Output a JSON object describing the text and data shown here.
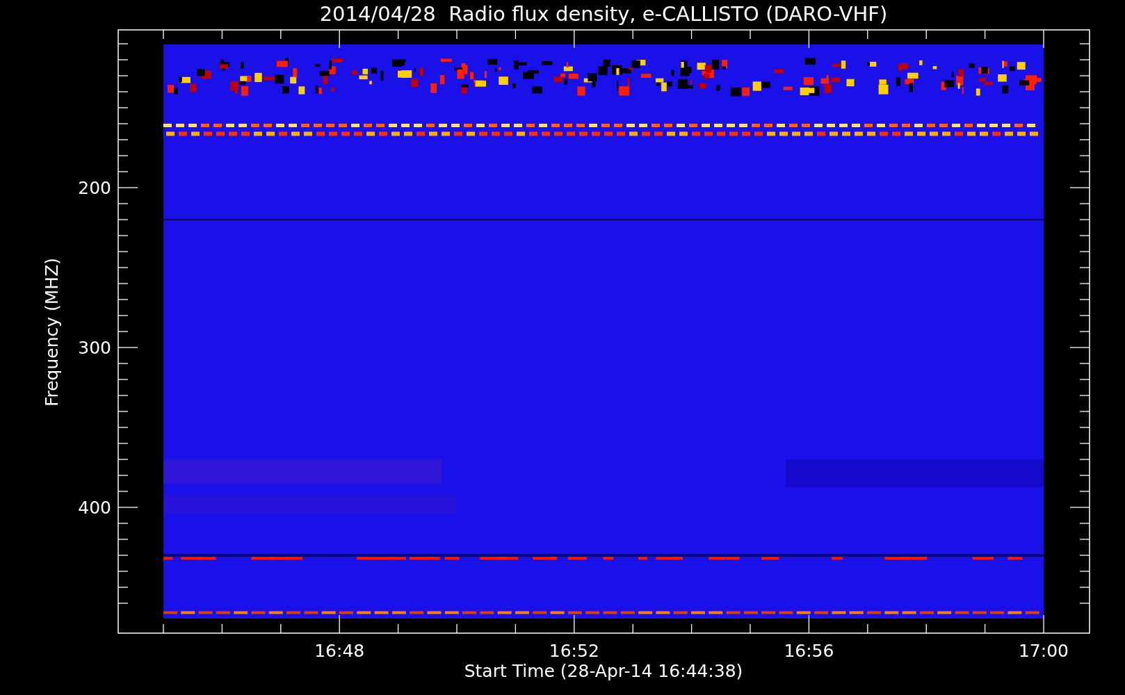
{
  "title": "2014/04/28  Radio flux density, e-CALLISTO (DARO-VHF)",
  "y_axis": {
    "label": "Frequency (MHZ)",
    "ticks": [
      "200",
      "300",
      "400"
    ]
  },
  "x_axis": {
    "label": "Start Time (28-Apr-14 16:44:38)",
    "ticks": [
      "16:48",
      "16:52",
      "16:56",
      "17:00"
    ]
  }
}
